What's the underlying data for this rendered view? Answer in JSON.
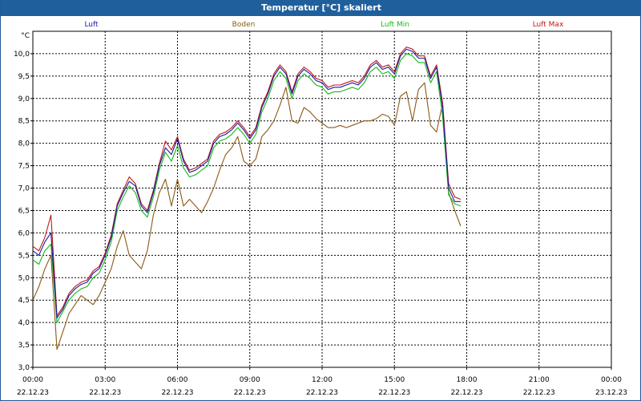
{
  "window": {
    "title": "Temperatur [°C] skaliert"
  },
  "chart_data": {
    "type": "line",
    "title": "Temperatur [°C] skaliert",
    "ylabel": "°C",
    "ylim": [
      3.0,
      10.5
    ],
    "yticks": [
      3.0,
      3.5,
      4.0,
      4.5,
      5.0,
      5.5,
      6.0,
      6.5,
      7.0,
      7.5,
      8.0,
      8.5,
      9.0,
      9.5,
      10.0
    ],
    "ytick_labels": [
      "3,0",
      "3,5",
      "4,0",
      "4,5",
      "5,0",
      "5,5",
      "6,0",
      "6,5",
      "7,0",
      "7,5",
      "8,0",
      "8,5",
      "9,0",
      "9,5",
      "10,0"
    ],
    "xlim": [
      0,
      24
    ],
    "xticks": [
      0,
      3,
      6,
      9,
      12,
      15,
      18,
      21,
      24
    ],
    "xtick_times": [
      "00:00",
      "03:00",
      "06:00",
      "09:00",
      "12:00",
      "15:00",
      "18:00",
      "21:00",
      "00:00"
    ],
    "xtick_dates": [
      "22.12.23",
      "22.12.23",
      "22.12.23",
      "22.12.23",
      "22.12.23",
      "22.12.23",
      "22.12.23",
      "22.12.23",
      "23.12.23"
    ],
    "grid": true,
    "legend_position": "top",
    "x": [
      0.0,
      0.25,
      0.5,
      0.75,
      1.0,
      1.25,
      1.5,
      1.75,
      2.0,
      2.25,
      2.5,
      2.75,
      3.0,
      3.25,
      3.5,
      3.75,
      4.0,
      4.25,
      4.5,
      4.75,
      5.0,
      5.25,
      5.5,
      5.75,
      6.0,
      6.25,
      6.5,
      6.75,
      7.0,
      7.25,
      7.5,
      7.75,
      8.0,
      8.25,
      8.5,
      8.75,
      9.0,
      9.25,
      9.5,
      9.75,
      10.0,
      10.25,
      10.5,
      10.75,
      11.0,
      11.25,
      11.5,
      11.75,
      12.0,
      12.25,
      12.5,
      12.75,
      13.0,
      13.25,
      13.5,
      13.75,
      14.0,
      14.25,
      14.5,
      14.75,
      15.0,
      15.25,
      15.5,
      15.75,
      16.0,
      16.25,
      16.5,
      16.75,
      17.0,
      17.25,
      17.5,
      17.75,
      18.0,
      18.25,
      18.5,
      18.75,
      19.0,
      19.25,
      19.5,
      19.75,
      20.0,
      20.25,
      20.5,
      20.75,
      21.0,
      21.25,
      21.5,
      21.75,
      22.0,
      22.25,
      22.5,
      22.75,
      23.0,
      23.25,
      23.5,
      23.75
    ],
    "series": [
      {
        "name": "Luft",
        "color": "#1a1aa8",
        "values": [
          5.6,
          5.5,
          5.8,
          6.0,
          4.1,
          4.3,
          4.6,
          4.75,
          4.85,
          4.9,
          5.1,
          5.2,
          5.5,
          5.9,
          6.6,
          6.9,
          7.15,
          7.05,
          6.6,
          6.45,
          6.9,
          7.5,
          7.9,
          7.75,
          8.1,
          7.6,
          7.35,
          7.4,
          7.5,
          7.6,
          8.0,
          8.15,
          8.2,
          8.3,
          8.45,
          8.3,
          8.1,
          8.3,
          8.8,
          9.1,
          9.5,
          9.7,
          9.55,
          9.1,
          9.5,
          9.65,
          9.55,
          9.4,
          9.35,
          9.2,
          9.25,
          9.25,
          9.3,
          9.35,
          9.3,
          9.45,
          9.7,
          9.8,
          9.65,
          9.7,
          9.55,
          9.95,
          10.1,
          10.05,
          9.9,
          9.9,
          9.45,
          9.7,
          8.8,
          7.0,
          6.7,
          6.7
        ]
      },
      {
        "name": "Boden",
        "color": "#8a5a14",
        "values": [
          4.5,
          4.8,
          5.2,
          5.5,
          3.4,
          3.8,
          4.2,
          4.4,
          4.6,
          4.5,
          4.4,
          4.6,
          4.9,
          5.2,
          5.7,
          6.05,
          5.5,
          5.35,
          5.2,
          5.6,
          6.4,
          6.9,
          7.2,
          6.6,
          7.2,
          6.6,
          6.75,
          6.6,
          6.45,
          6.7,
          7.0,
          7.4,
          7.75,
          7.9,
          8.15,
          7.6,
          7.5,
          7.65,
          8.15,
          8.3,
          8.5,
          8.85,
          9.25,
          8.5,
          8.45,
          8.8,
          8.7,
          8.55,
          8.45,
          8.35,
          8.35,
          8.4,
          8.35,
          8.4,
          8.45,
          8.5,
          8.5,
          8.55,
          8.65,
          8.6,
          8.4,
          9.05,
          9.15,
          8.5,
          9.2,
          9.35,
          8.4,
          8.25,
          8.9,
          6.9,
          6.5,
          6.15
        ]
      },
      {
        "name": "Luft Min",
        "color": "#18b818",
        "values": [
          5.4,
          5.3,
          5.6,
          5.75,
          4.0,
          4.25,
          4.5,
          4.65,
          4.75,
          4.8,
          5.0,
          5.1,
          5.4,
          5.8,
          6.5,
          6.8,
          7.05,
          6.9,
          6.5,
          6.35,
          6.8,
          7.4,
          7.8,
          7.6,
          7.95,
          7.45,
          7.25,
          7.3,
          7.4,
          7.5,
          7.9,
          8.05,
          8.1,
          8.2,
          8.35,
          8.2,
          8.0,
          8.2,
          8.7,
          9.0,
          9.4,
          9.6,
          9.45,
          9.0,
          9.4,
          9.55,
          9.45,
          9.3,
          9.25,
          9.1,
          9.15,
          9.15,
          9.2,
          9.25,
          9.2,
          9.35,
          9.6,
          9.7,
          9.55,
          9.6,
          9.45,
          9.85,
          10.0,
          9.95,
          9.8,
          9.8,
          9.35,
          9.6,
          8.6,
          6.85,
          6.65,
          6.6
        ]
      },
      {
        "name": "Luft Max",
        "color": "#c01818",
        "values": [
          5.7,
          5.6,
          5.9,
          6.4,
          4.15,
          4.35,
          4.65,
          4.8,
          4.9,
          4.95,
          5.15,
          5.25,
          5.55,
          5.95,
          6.65,
          6.95,
          7.25,
          7.1,
          6.65,
          6.5,
          6.95,
          7.55,
          8.05,
          7.85,
          8.15,
          7.65,
          7.4,
          7.45,
          7.55,
          7.65,
          8.05,
          8.2,
          8.25,
          8.35,
          8.5,
          8.35,
          8.15,
          8.35,
          8.85,
          9.15,
          9.55,
          9.75,
          9.6,
          9.15,
          9.55,
          9.7,
          9.6,
          9.45,
          9.4,
          9.25,
          9.3,
          9.3,
          9.35,
          9.4,
          9.35,
          9.5,
          9.75,
          9.85,
          9.7,
          9.75,
          9.6,
          10.0,
          10.15,
          10.1,
          9.95,
          9.95,
          9.5,
          9.75,
          8.9,
          7.1,
          6.8,
          6.75
        ]
      }
    ]
  }
}
